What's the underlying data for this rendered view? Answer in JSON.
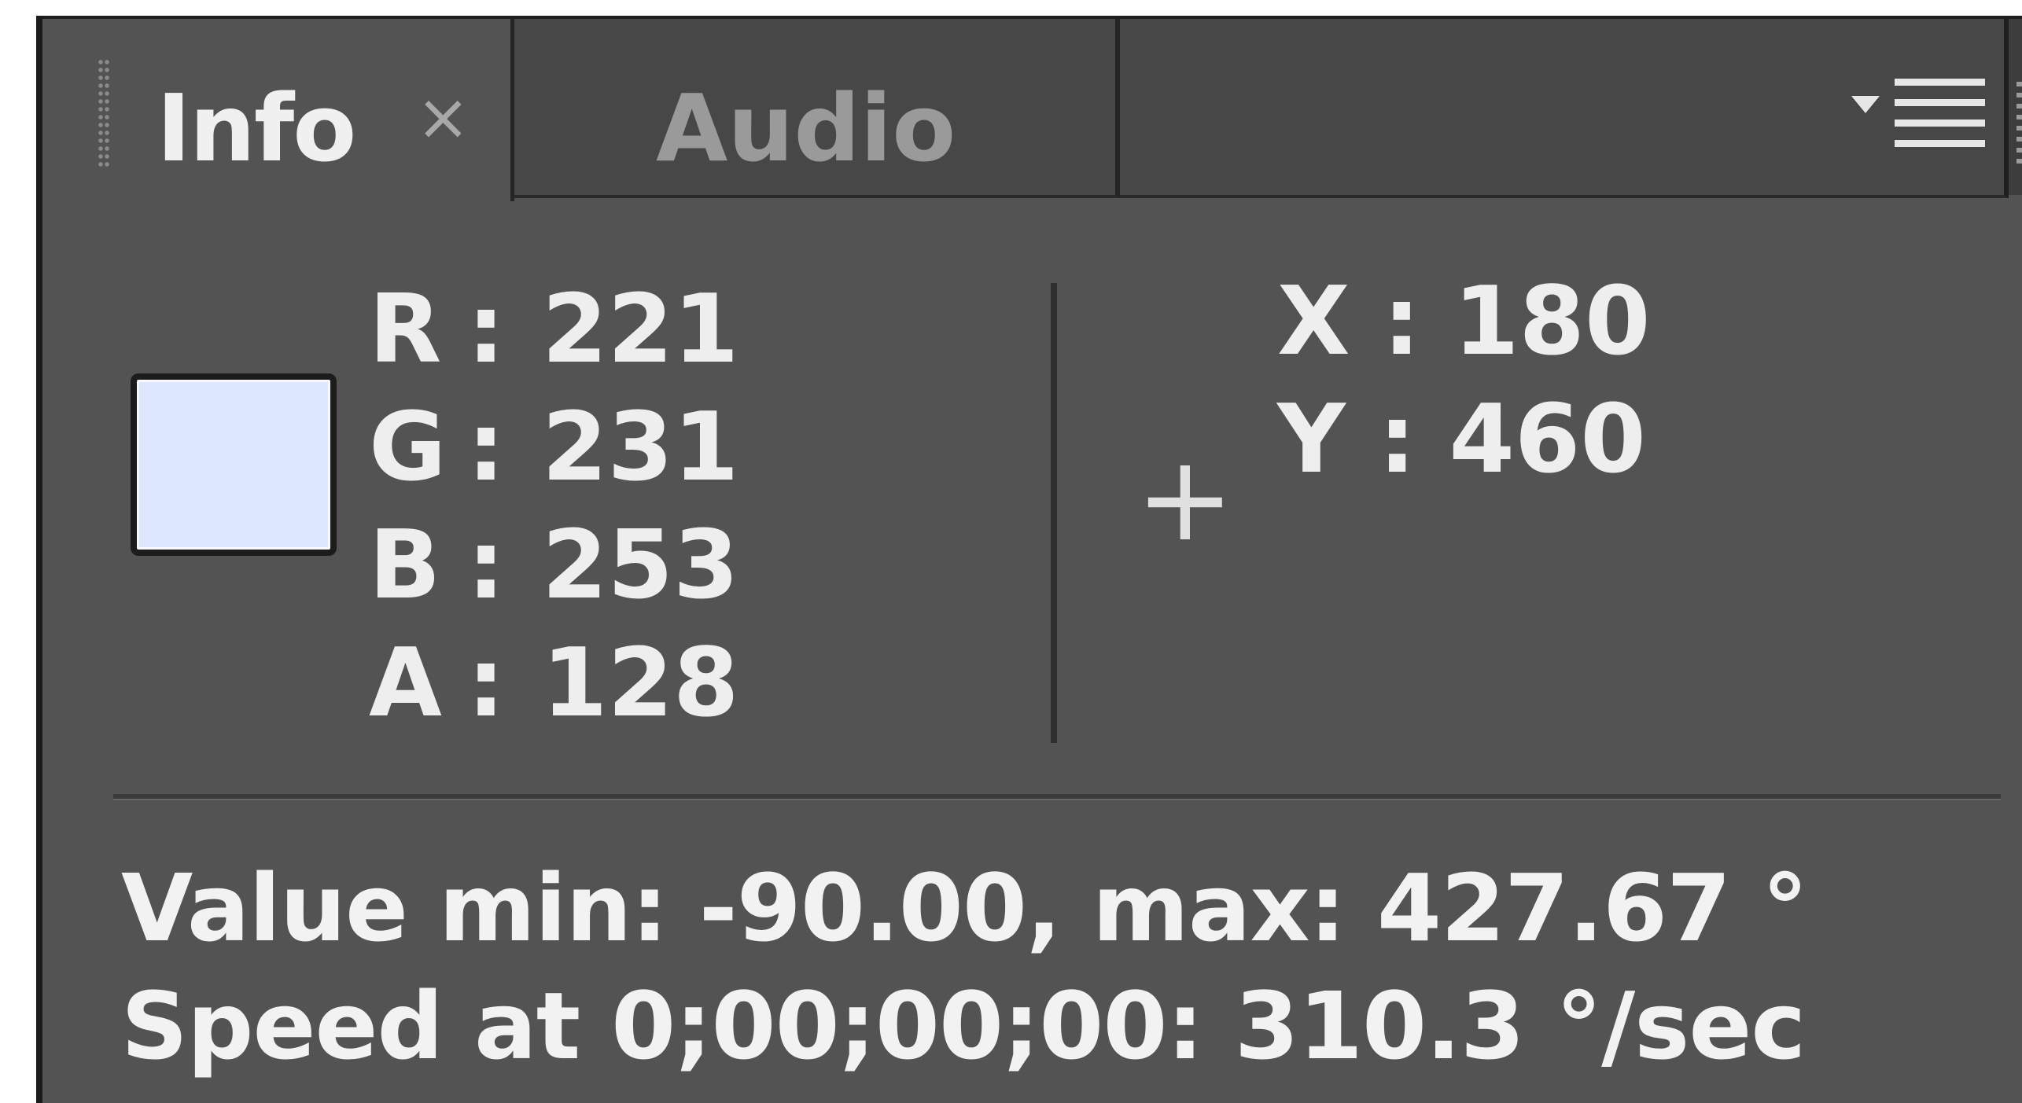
{
  "tabs": {
    "info_label": "Info",
    "info_close": "×",
    "audio_label": "Audio"
  },
  "icons": {
    "panel_grip": "grip-dots-icon",
    "close": "close-icon",
    "panel_menu": "panel-menu-icon",
    "crosshair": "crosshair-icon"
  },
  "color": {
    "swatch_hex": "#dde7fd",
    "r_label": "R",
    "r_value": "221",
    "g_label": "G",
    "g_value": "231",
    "b_label": "B",
    "b_value": "253",
    "a_label": "A",
    "a_value": "128",
    "separator": ":"
  },
  "position": {
    "crosshair_glyph": "+",
    "x_text": "X : 180",
    "y_text": "Y : 460"
  },
  "readout": {
    "value_line": "Value min: -90.00, max: 427.67 °",
    "speed_line": "Speed at 0;00;00;00: 310.3 °/sec"
  }
}
